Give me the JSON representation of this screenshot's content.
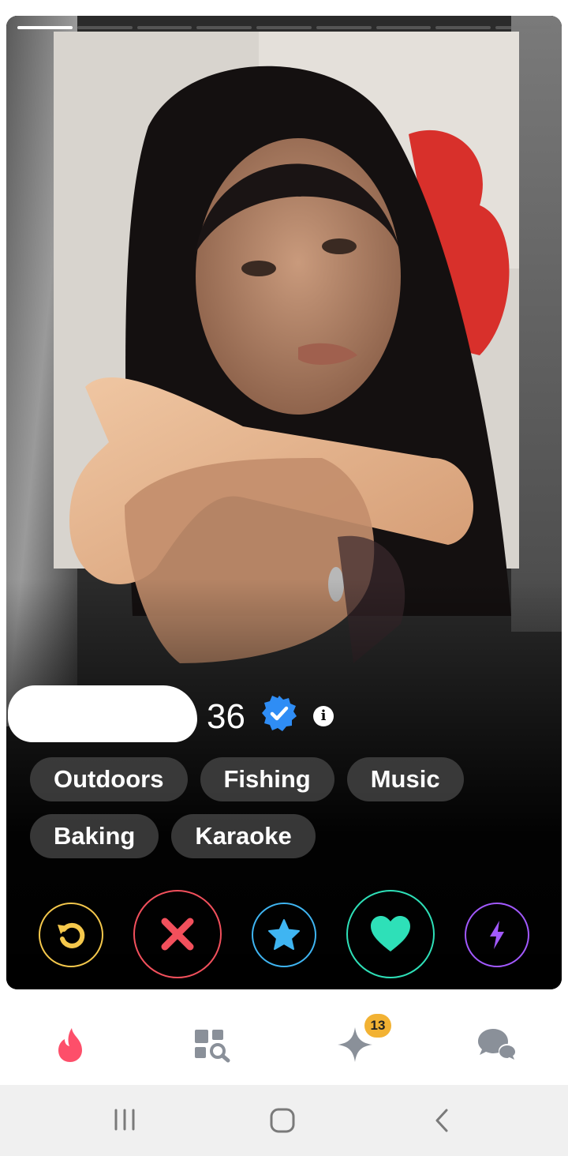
{
  "profile": {
    "age": "36",
    "info_glyph": "i",
    "photo_count": 9,
    "active_photo": 1,
    "verified": true
  },
  "interests": {
    "row1": [
      "Outdoors",
      "Fishing",
      "Music"
    ],
    "row2": [
      "Baking",
      "Karaoke"
    ]
  },
  "actions": {
    "rewind": {
      "icon": "rewind-icon",
      "color": "#f5c84c"
    },
    "nope": {
      "icon": "close-icon",
      "color": "#f2505c"
    },
    "super_like": {
      "icon": "star-icon",
      "color": "#3fb5f2"
    },
    "like": {
      "icon": "heart-icon",
      "color": "#2ee0b8"
    },
    "boost": {
      "icon": "lightning-icon",
      "color": "#a259ff"
    }
  },
  "nav": {
    "discover": {
      "icon": "flame-icon",
      "color": "#fd4f6a"
    },
    "explore": {
      "icon": "explore-grid-icon"
    },
    "likes": {
      "icon": "sparkle-icon",
      "badge": "13"
    },
    "messages": {
      "icon": "chat-bubbles-icon"
    }
  },
  "system_nav": {
    "recents": "recents-icon",
    "home": "home-icon",
    "back": "back-icon"
  }
}
